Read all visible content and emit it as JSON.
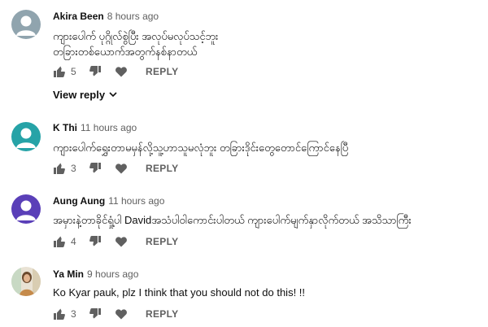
{
  "comments": [
    {
      "author": "Akira Been",
      "time": "8 hours ago",
      "text_lines": [
        "ကျားပေါက် ပုဂ္ဂိုလ်စွဲပြီး အလုပ်မလုပ်သင့်ဘူး",
        "တခြားတစ်ယောက်အတွက်နစ်နာတယ်"
      ],
      "likes": "5",
      "reply_label": "REPLY",
      "avatar_color": "#90a4ae"
    },
    {
      "author": "K Thi",
      "time": "11 hours ago",
      "text_lines": [
        "ကျားပေါက်ရွှေးတာမမှန်လို့သူ့ဟာသူမလုံဘူး တခြားဒိုင်းတွေတောင်ကြောင်နေပြီ"
      ],
      "likes": "3",
      "reply_label": "REPLY",
      "avatar_color": "#26a3a7"
    },
    {
      "author": "Aung Aung",
      "time": "11 hours ago",
      "text_lines": [
        "အမှားနဲ့တာခိုင်ရှုံ့ပါ  Davidအသံပါဝါကောင်းပါတယ်  ကျားပေါက်မျက်နှာလိုက်တယ် အသိသာကြီး"
      ],
      "likes": "4",
      "reply_label": "REPLY",
      "avatar_color": "#5a3fb8"
    },
    {
      "author": "Ya Min",
      "time": "9 hours ago",
      "text_lines": [
        "Ko Kyar pauk, plz I think that you should not do this! !!"
      ],
      "likes": "3",
      "reply_label": "REPLY",
      "avatar_color": "#c9b28a"
    }
  ],
  "view_reply_label": "View reply"
}
